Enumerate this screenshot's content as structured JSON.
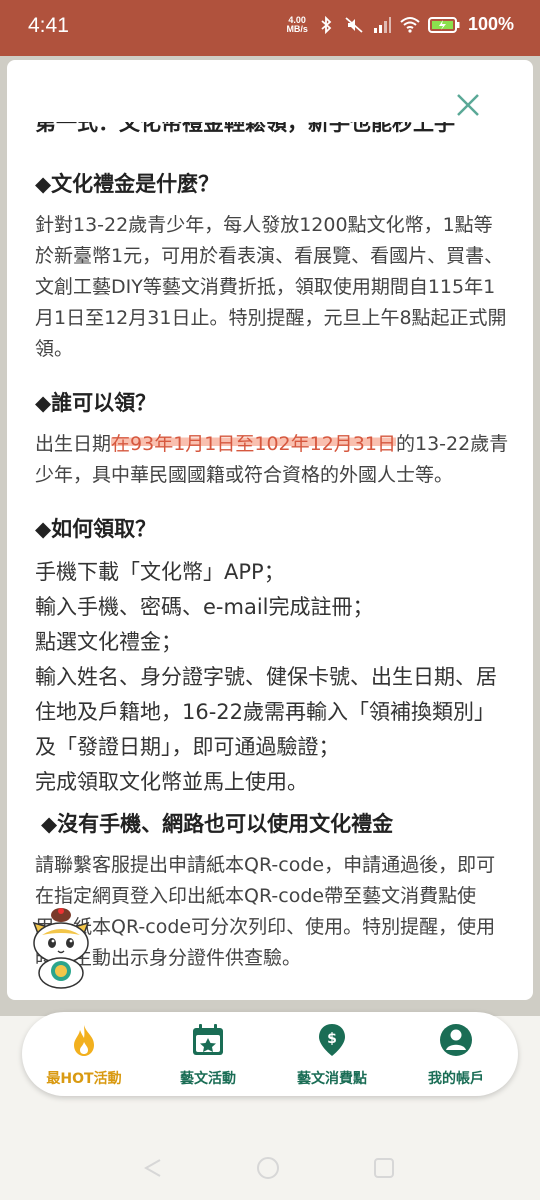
{
  "status": {
    "time": "4:41",
    "net_speed_value": "4.00",
    "net_speed_unit": "MB/s",
    "battery": "100%"
  },
  "modal": {
    "cut_title": "第一式：文化幣禮金輕鬆領，新手也能秒上手",
    "sections": {
      "what": {
        "title": "◆文化禮金是什麼？",
        "body": "針對13-22歲青少年，每人發放1200點文化幣，1點等於新臺幣1元，可用於看表演、看展覽、看國片、買書、文創工藝DIY等藝文消費折抵，領取使用期間自115年1月1日至12月31日止。特別提醒，元旦上午8點起正式開領。"
      },
      "who": {
        "title": "◆誰可以領？",
        "body_prefix": "出生日期",
        "body_highlight": "在93年1月1日至102年12月31日",
        "body_suffix": "的13-22歲青少年，具中華民國國籍或符合資格的外國人士等。"
      },
      "how": {
        "title": "◆如何領取？",
        "step1": "手機下載「文化幣」APP；",
        "step2": "輸入手機、密碼、e-mail完成註冊；",
        "step3": "點選文化禮金；",
        "step4": "輸入姓名、身分證字號、健保卡號、出生日期、居住地及戶籍地，16-22歲需再輸入「領補換類別」及「發證日期」，即可通過驗證；",
        "step5": "完成領取文化幣並馬上使用。"
      },
      "nophone": {
        "title": "◆沒有手機、網路也可以使用文化禮金",
        "body": "請聯繫客服提出申請紙本QR-code，申請通過後，即可在指定網頁登入印出紙本QR-code帶至藝文消費點使用，紙本QR-code可分次列印、使用。特別提醒，使用時應主動出示身分證件供查驗。"
      }
    }
  },
  "nav": {
    "items": [
      {
        "label": "最HOT活動",
        "icon": "flame-icon"
      },
      {
        "label": "藝文活動",
        "icon": "calendar-icon"
      },
      {
        "label": "藝文消費點",
        "icon": "location-dollar-icon"
      },
      {
        "label": "我的帳戶",
        "icon": "user-icon"
      }
    ],
    "active_index": 0
  },
  "colors": {
    "status_bar": "#b0523d",
    "accent_green": "#1a6d55",
    "accent_gold": "#d99a12",
    "highlight": "#f48c6e"
  }
}
